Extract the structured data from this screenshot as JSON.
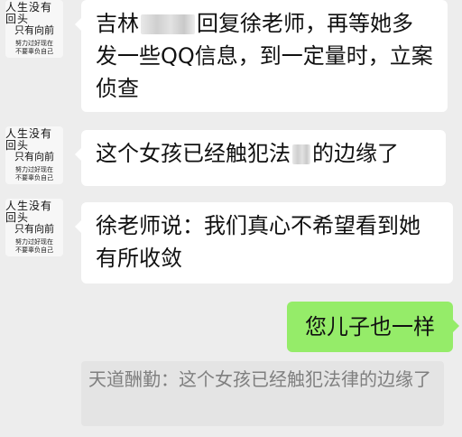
{
  "avatar": {
    "line1": "人生没有回头",
    "line2": "只有向前",
    "line3": "努力过好现在",
    "line4": "不要辜负自己"
  },
  "messages": [
    {
      "side": "incoming",
      "before_redaction": "吉林",
      "after_redaction": "回复徐老师，再等她多发一些QQ信息，到一定量时，立案侦查"
    },
    {
      "side": "incoming",
      "before_redaction": "这个女孩已经触犯法",
      "after_redaction": "的边缘了"
    },
    {
      "side": "incoming",
      "text": "徐老师说：我们真心不希望看到她有所收敛"
    },
    {
      "side": "outgoing",
      "text": "您儿子也一样"
    }
  ],
  "quote": {
    "text": "天道酬勤：这个女孩已经触犯法律的边缘了"
  },
  "colors": {
    "background": "#ededed",
    "incoming_bubble": "#ffffff",
    "outgoing_bubble": "#95ec69",
    "quote_bg": "#e4e4e4",
    "quote_text": "#7f7f7f"
  }
}
